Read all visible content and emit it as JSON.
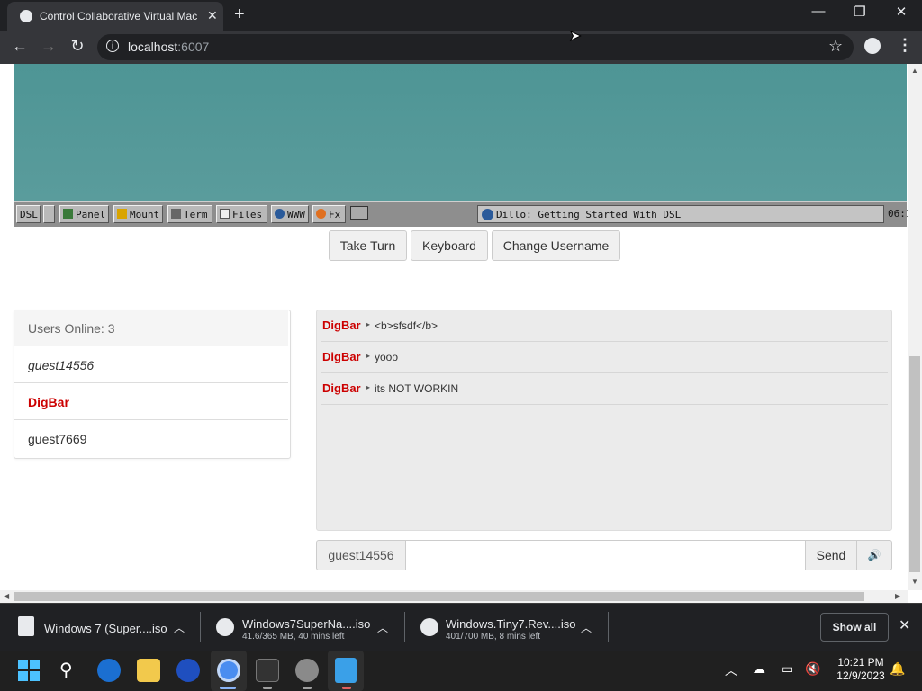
{
  "browser": {
    "tab_title": "Control Collaborative Virtual Mac",
    "url_host": "localhost",
    "url_port": ":6007",
    "icons": {
      "back": "back-arrow-icon",
      "forward": "forward-arrow-icon",
      "reload": "reload-icon",
      "star": "star-icon",
      "profile": "profile-icon",
      "menu": "kebab-menu-icon"
    }
  },
  "vm": {
    "taskbar_buttons": [
      "DSL",
      "_",
      "Panel",
      "Mount",
      "Term",
      "Files",
      "WWW",
      "Fx"
    ],
    "active_window": "Dillo: Getting Started With DSL",
    "clock": "06:1"
  },
  "controls": {
    "take_turn": "Take Turn",
    "keyboard": "Keyboard",
    "change_username": "Change Username"
  },
  "users": {
    "header": "Users Online: 3",
    "list": [
      {
        "name": "guest14556",
        "style": "italic"
      },
      {
        "name": "DigBar",
        "style": "admin"
      },
      {
        "name": "guest7669",
        "style": "normal"
      }
    ]
  },
  "chat": {
    "messages": [
      {
        "user": "DigBar",
        "text": "<b>sfsdf</b>"
      },
      {
        "user": "DigBar",
        "text": "yooo"
      },
      {
        "user": "DigBar",
        "text": "its NOT WORKIN"
      }
    ],
    "username": "guest14556",
    "input_value": "",
    "send_label": "Send",
    "sound_icon": "speaker-icon"
  },
  "downloads": {
    "items": [
      {
        "name": "Windows 7 (Super....iso",
        "status": ""
      },
      {
        "name": "Windows7SuperNa....iso",
        "status": "41.6/365 MB, 40 mins left"
      },
      {
        "name": "Windows.Tiny7.Rev....iso",
        "status": "401/700 MB, 8 mins left"
      }
    ],
    "show_all": "Show all"
  },
  "taskbar": {
    "time": "10:21 PM",
    "date": "12/9/2023"
  },
  "colors": {
    "admin_red": "#cc0000",
    "vm_teal": "#559999"
  }
}
